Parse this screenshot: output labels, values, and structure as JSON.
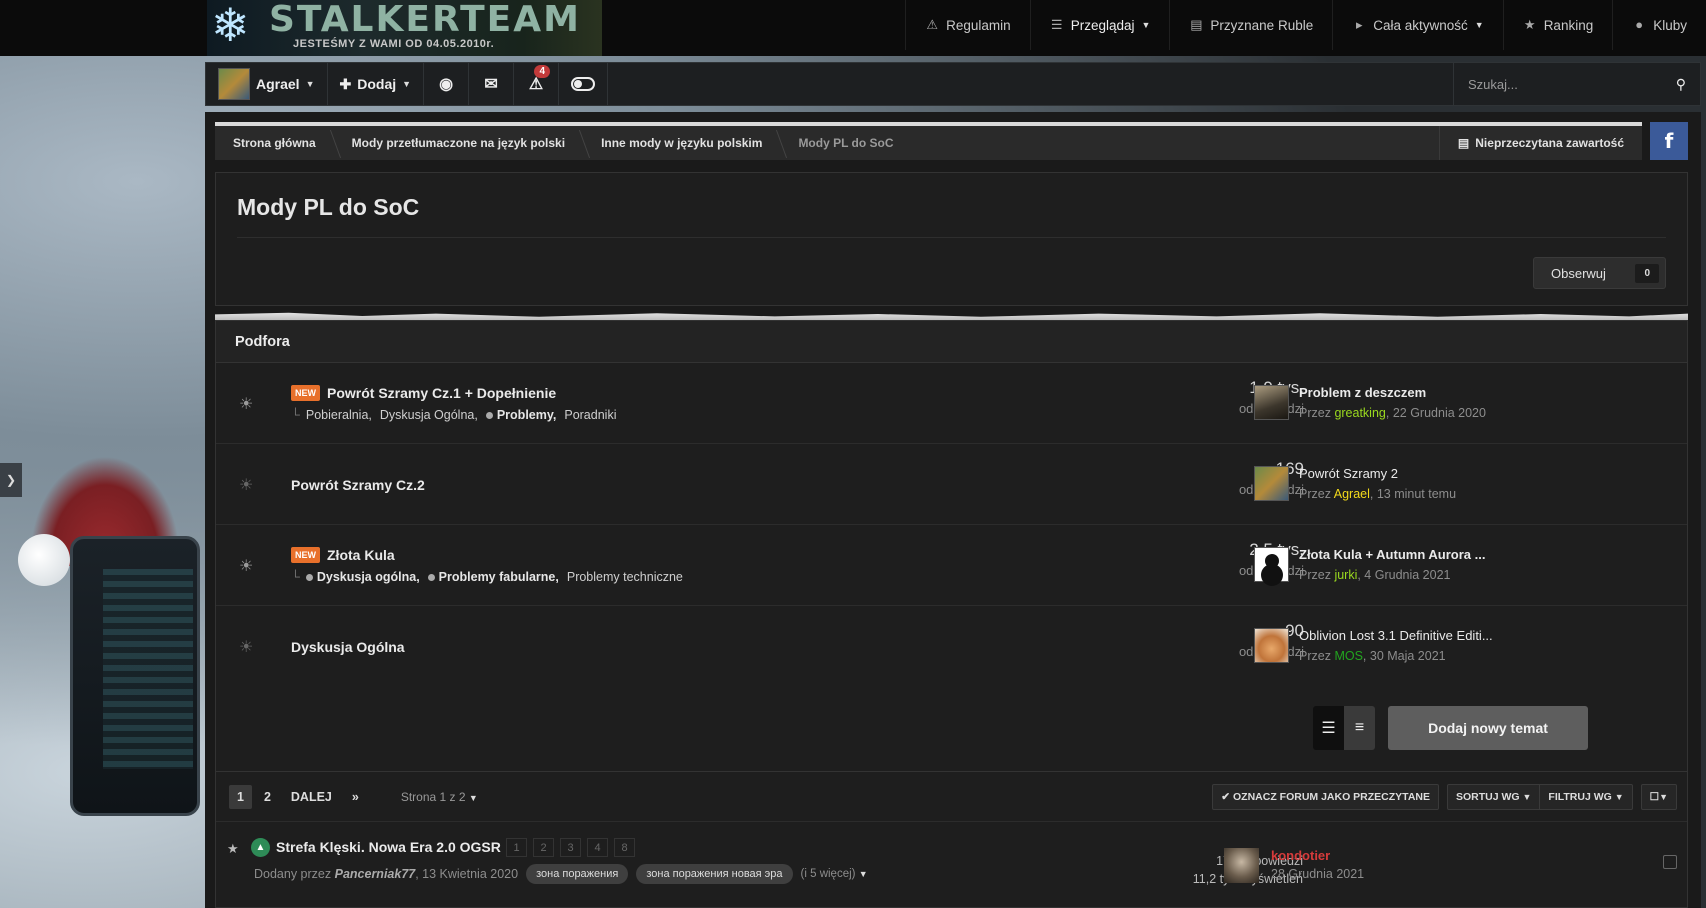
{
  "site": {
    "logo_title": "STALKERTEAM",
    "logo_subtitle": "JESTEŚMY Z WAMI OD 04.05.2010r."
  },
  "topnav": [
    {
      "label": "Regulamin",
      "icon": "warning-icon"
    },
    {
      "label": "Przeglądaj",
      "icon": "list-icon",
      "caret": true
    },
    {
      "label": "Przyznane Ruble",
      "icon": "document-icon"
    },
    {
      "label": "Cała aktywność",
      "icon": "megaphone-icon",
      "caret": true
    },
    {
      "label": "Ranking",
      "icon": "trophy-icon"
    },
    {
      "label": "Kluby",
      "icon": "users-icon"
    }
  ],
  "userbar": {
    "username": "Agrael",
    "add_label": "Dodaj",
    "notifications_count": "4",
    "search_placeholder": "Szukaj..."
  },
  "breadcrumb": [
    "Strona główna",
    "Mody przetłumaczone na język polski",
    "Inne mody w języku polskim",
    "Mody PL do SoC"
  ],
  "unread_label": "Nieprzeczytana zawartość",
  "facebook_label": "f",
  "page": {
    "title": "Mody PL do SoC",
    "follow_label": "Obserwuj",
    "follow_count": "0"
  },
  "subforums": {
    "header": "Podfora",
    "rows": [
      {
        "new": "NEW",
        "title": "Powrót Szramy Cz.1 + Dopełnienie",
        "subs": [
          {
            "label": "Pobieralnia,",
            "bold": false,
            "dot": false
          },
          {
            "label": "Dyskusja Ogólna,",
            "bold": false,
            "dot": false
          },
          {
            "label": "Problemy,",
            "bold": true,
            "dot": true
          },
          {
            "label": "Poradniki",
            "bold": false,
            "dot": false
          }
        ],
        "count": "1,9 tys.",
        "count_label": "odpowiedzi",
        "last_title": "Problem z deszczem",
        "by_prefix": "Przez",
        "last_user": "greatking",
        "last_user_color": "#9ad91f",
        "last_date": ", 22 Grudnia 2020"
      },
      {
        "new": "",
        "title": "Powrót Szramy Cz.2",
        "subs": [],
        "count": "169",
        "count_label": "odpowiedzi",
        "last_title": "Powrót Szramy 2",
        "by_prefix": "Przez",
        "last_user": "Agrael",
        "last_user_color": "#f2d91b",
        "last_date": ", 13 minut temu"
      },
      {
        "new": "NEW",
        "title": "Złota Kula",
        "subs": [
          {
            "label": "Dyskusja ogólna,",
            "bold": true,
            "dot": true
          },
          {
            "label": "Problemy fabularne,",
            "bold": true,
            "dot": true
          },
          {
            "label": "Problemy techniczne",
            "bold": false,
            "dot": false
          }
        ],
        "count": "2,5 tys.",
        "count_label": "odpowiedzi",
        "last_title": "Złota Kula + Autumn Aurora ...",
        "by_prefix": "Przez",
        "last_user": "jurki",
        "last_user_color": "#9ad91f",
        "last_date": ", 4 Grudnia 2021"
      },
      {
        "new": "",
        "title": "Dyskusja Ogólna",
        "subs": [],
        "count": "90",
        "count_label": "odpowiedzi",
        "last_title": "Oblivion Lost 3.1 Definitive Editi...",
        "by_prefix": "Przez",
        "last_user": "MOS",
        "last_user_color": "#22a41e",
        "last_date": ", 30 Maja 2021"
      }
    ]
  },
  "new_topic_label": "Dodaj nowy temat",
  "pager": {
    "pages": [
      "1",
      "2"
    ],
    "next_label": "DALEJ",
    "page_of": "Strona 1 z 2",
    "mark_read": "OZNACZ FORUM JAKO PRZECZYTANE",
    "sort": "SORTUJ WG",
    "filter": "FILTRUJ WG"
  },
  "topics": [
    {
      "title": "Strefa Klęski. Nowa Era 2.0 OGSR",
      "mini_pages": [
        "1",
        "2",
        "3",
        "4",
        "8"
      ],
      "posted_prefix": "Dodany przez",
      "author": "Pancerniak77",
      "posted_date": ", 13 Kwietnia 2020",
      "tags": [
        "зона поражения",
        "зона поражения новая эра"
      ],
      "more_tags": "(i 5 więcej)",
      "replies": "172 odpowiedzi",
      "views": "11,2 tys. wyświetleń",
      "last_user": "kondotier",
      "last_user_color": "#d63b3b",
      "last_date": "28 Grudnia 2021"
    }
  ]
}
